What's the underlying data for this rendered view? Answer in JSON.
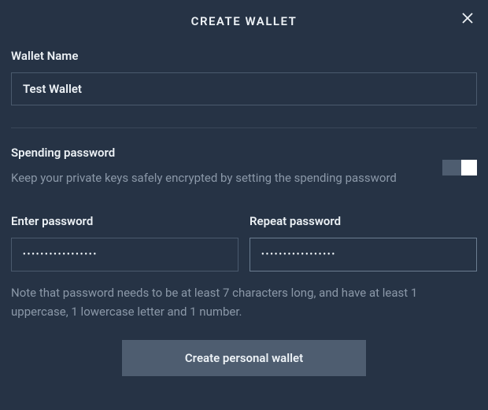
{
  "header": {
    "title": "CREATE WALLET"
  },
  "walletName": {
    "label": "Wallet Name",
    "value": "Test Wallet"
  },
  "spending": {
    "label": "Spending password",
    "hint": "Keep your private keys safely encrypted by setting the spending password",
    "enabled": true
  },
  "enterPassword": {
    "label": "Enter password",
    "value": "•••••••••••••••••"
  },
  "repeatPassword": {
    "label": "Repeat password",
    "value": "•••••••••••••••••"
  },
  "note": "Note that password needs to be at least 7 characters long, and have at least 1 uppercase, 1 lowercase letter and 1 number.",
  "submit": {
    "label": "Create personal wallet"
  }
}
